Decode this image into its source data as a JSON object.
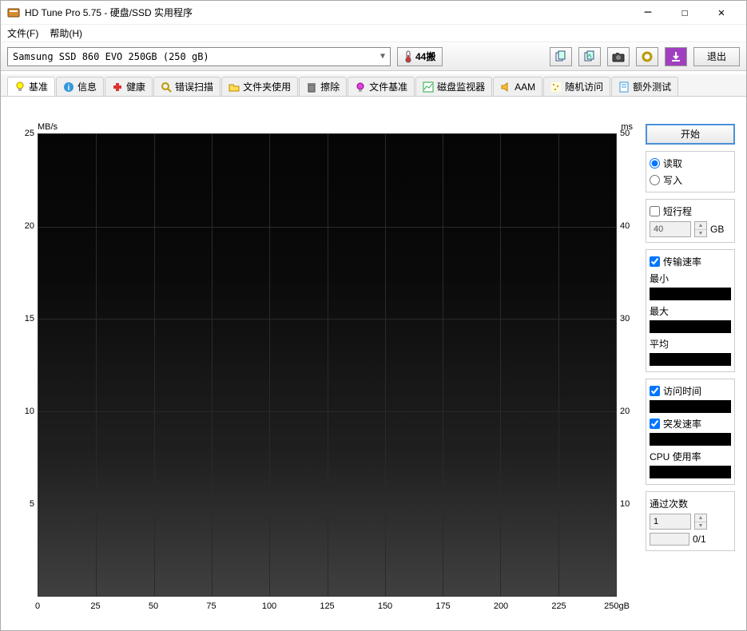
{
  "window": {
    "title": "HD Tune Pro 5.75 - 硬盘/SSD 实用程序"
  },
  "menu": {
    "file": "文件(F)",
    "help": "帮助(H)"
  },
  "toolbar": {
    "drive": "Samsung SSD 860 EVO 250GB (250 gB)",
    "temp": "44搬",
    "exit": "退出"
  },
  "tabs": [
    {
      "label": "基准",
      "icon": "bulb"
    },
    {
      "label": "信息",
      "icon": "info"
    },
    {
      "label": "健康",
      "icon": "plus"
    },
    {
      "label": "错误扫描",
      "icon": "search"
    },
    {
      "label": "文件夹使用",
      "icon": "folder"
    },
    {
      "label": "擦除",
      "icon": "trash"
    },
    {
      "label": "文件基准",
      "icon": "bulb2"
    },
    {
      "label": "磁盘监视器",
      "icon": "chart"
    },
    {
      "label": "AAM",
      "icon": "speaker"
    },
    {
      "label": "随机访问",
      "icon": "dots"
    },
    {
      "label": "额外测试",
      "icon": "page"
    }
  ],
  "chart": {
    "unit_left": "MB/s",
    "unit_right": "ms",
    "y_left": [
      "25",
      "20",
      "15",
      "10",
      "5",
      ""
    ],
    "y_right": [
      "50",
      "40",
      "30",
      "20",
      "10",
      ""
    ],
    "x": [
      "0",
      "25",
      "50",
      "75",
      "100",
      "125",
      "150",
      "175",
      "200",
      "225",
      "250gB"
    ]
  },
  "chart_data": {
    "type": "line",
    "title": "",
    "xlabel": "gB",
    "series": [
      {
        "name": "传输速率",
        "unit": "MB/s",
        "y_axis": "left",
        "values": []
      },
      {
        "name": "访问时间",
        "unit": "ms",
        "y_axis": "right",
        "values": []
      }
    ],
    "x_range": [
      0,
      250
    ],
    "y_left_range": [
      0,
      25
    ],
    "y_right_range": [
      0,
      50
    ],
    "x_ticks": [
      0,
      25,
      50,
      75,
      100,
      125,
      150,
      175,
      200,
      225,
      250
    ],
    "y_left_ticks": [
      0,
      5,
      10,
      15,
      20,
      25
    ],
    "y_right_ticks": [
      0,
      10,
      20,
      30,
      40,
      50
    ]
  },
  "side": {
    "start": "开始",
    "read": "读取",
    "write": "写入",
    "short_stroke": "短行程",
    "short_stroke_val": "40",
    "short_stroke_unit": "GB",
    "transfer_rate": "传输速率",
    "min": "最小",
    "max": "最大",
    "avg": "平均",
    "access_time": "访问时间",
    "burst_rate": "突发速率",
    "cpu_usage": "CPU 使用率",
    "passes": "通过次数",
    "passes_val": "1",
    "progress_text": "0/1"
  }
}
